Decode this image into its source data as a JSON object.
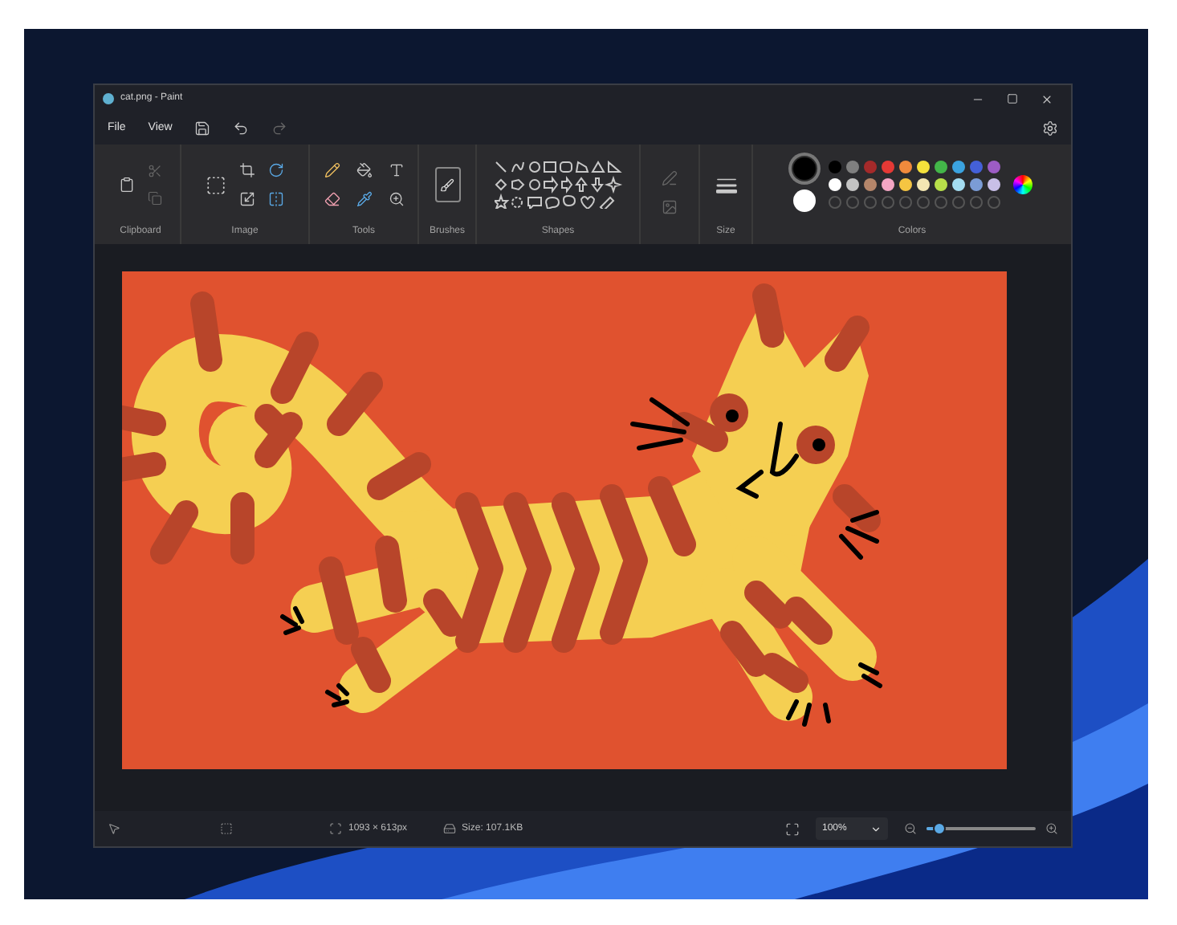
{
  "window": {
    "title": "cat.png - Paint"
  },
  "menu": [
    {
      "label": "File"
    },
    {
      "label": "View"
    }
  ],
  "ribbon": {
    "groups": [
      "Clipboard",
      "Image",
      "Tools",
      "Brushes",
      "Shapes",
      "Size",
      "Colors"
    ]
  },
  "colors": {
    "primary": {
      "color": "#000000",
      "selected": true
    },
    "secondary": {
      "color": "#ffffff",
      "selected": false
    },
    "palette": [
      {
        "color": "#000000"
      },
      {
        "color": "#7f7f7f"
      },
      {
        "color": "#a52a2a"
      },
      {
        "color": "#e53935"
      },
      {
        "color": "#f08a3c"
      },
      {
        "color": "#f5e13b"
      },
      {
        "color": "#43b649"
      },
      {
        "color": "#3ba3e0"
      },
      {
        "color": "#4460d8"
      },
      {
        "color": "#9c5cc4"
      },
      {
        "color": "#ffffff"
      },
      {
        "color": "#c3c3c3"
      },
      {
        "color": "#b5866a"
      },
      {
        "color": "#f4a6c4"
      },
      {
        "color": "#f5c542"
      },
      {
        "color": "#f3e6b2"
      },
      {
        "color": "#b8e04a"
      },
      {
        "color": "#a4dcf0"
      },
      {
        "color": "#7b9cd6"
      },
      {
        "color": "#c8bfe7"
      }
    ]
  },
  "status_bar": {
    "dimensions": "1093 × 613px",
    "size": "Size: 107.1KB",
    "zoom": "100%",
    "zoom_slider": {
      "level": 0.12
    }
  }
}
